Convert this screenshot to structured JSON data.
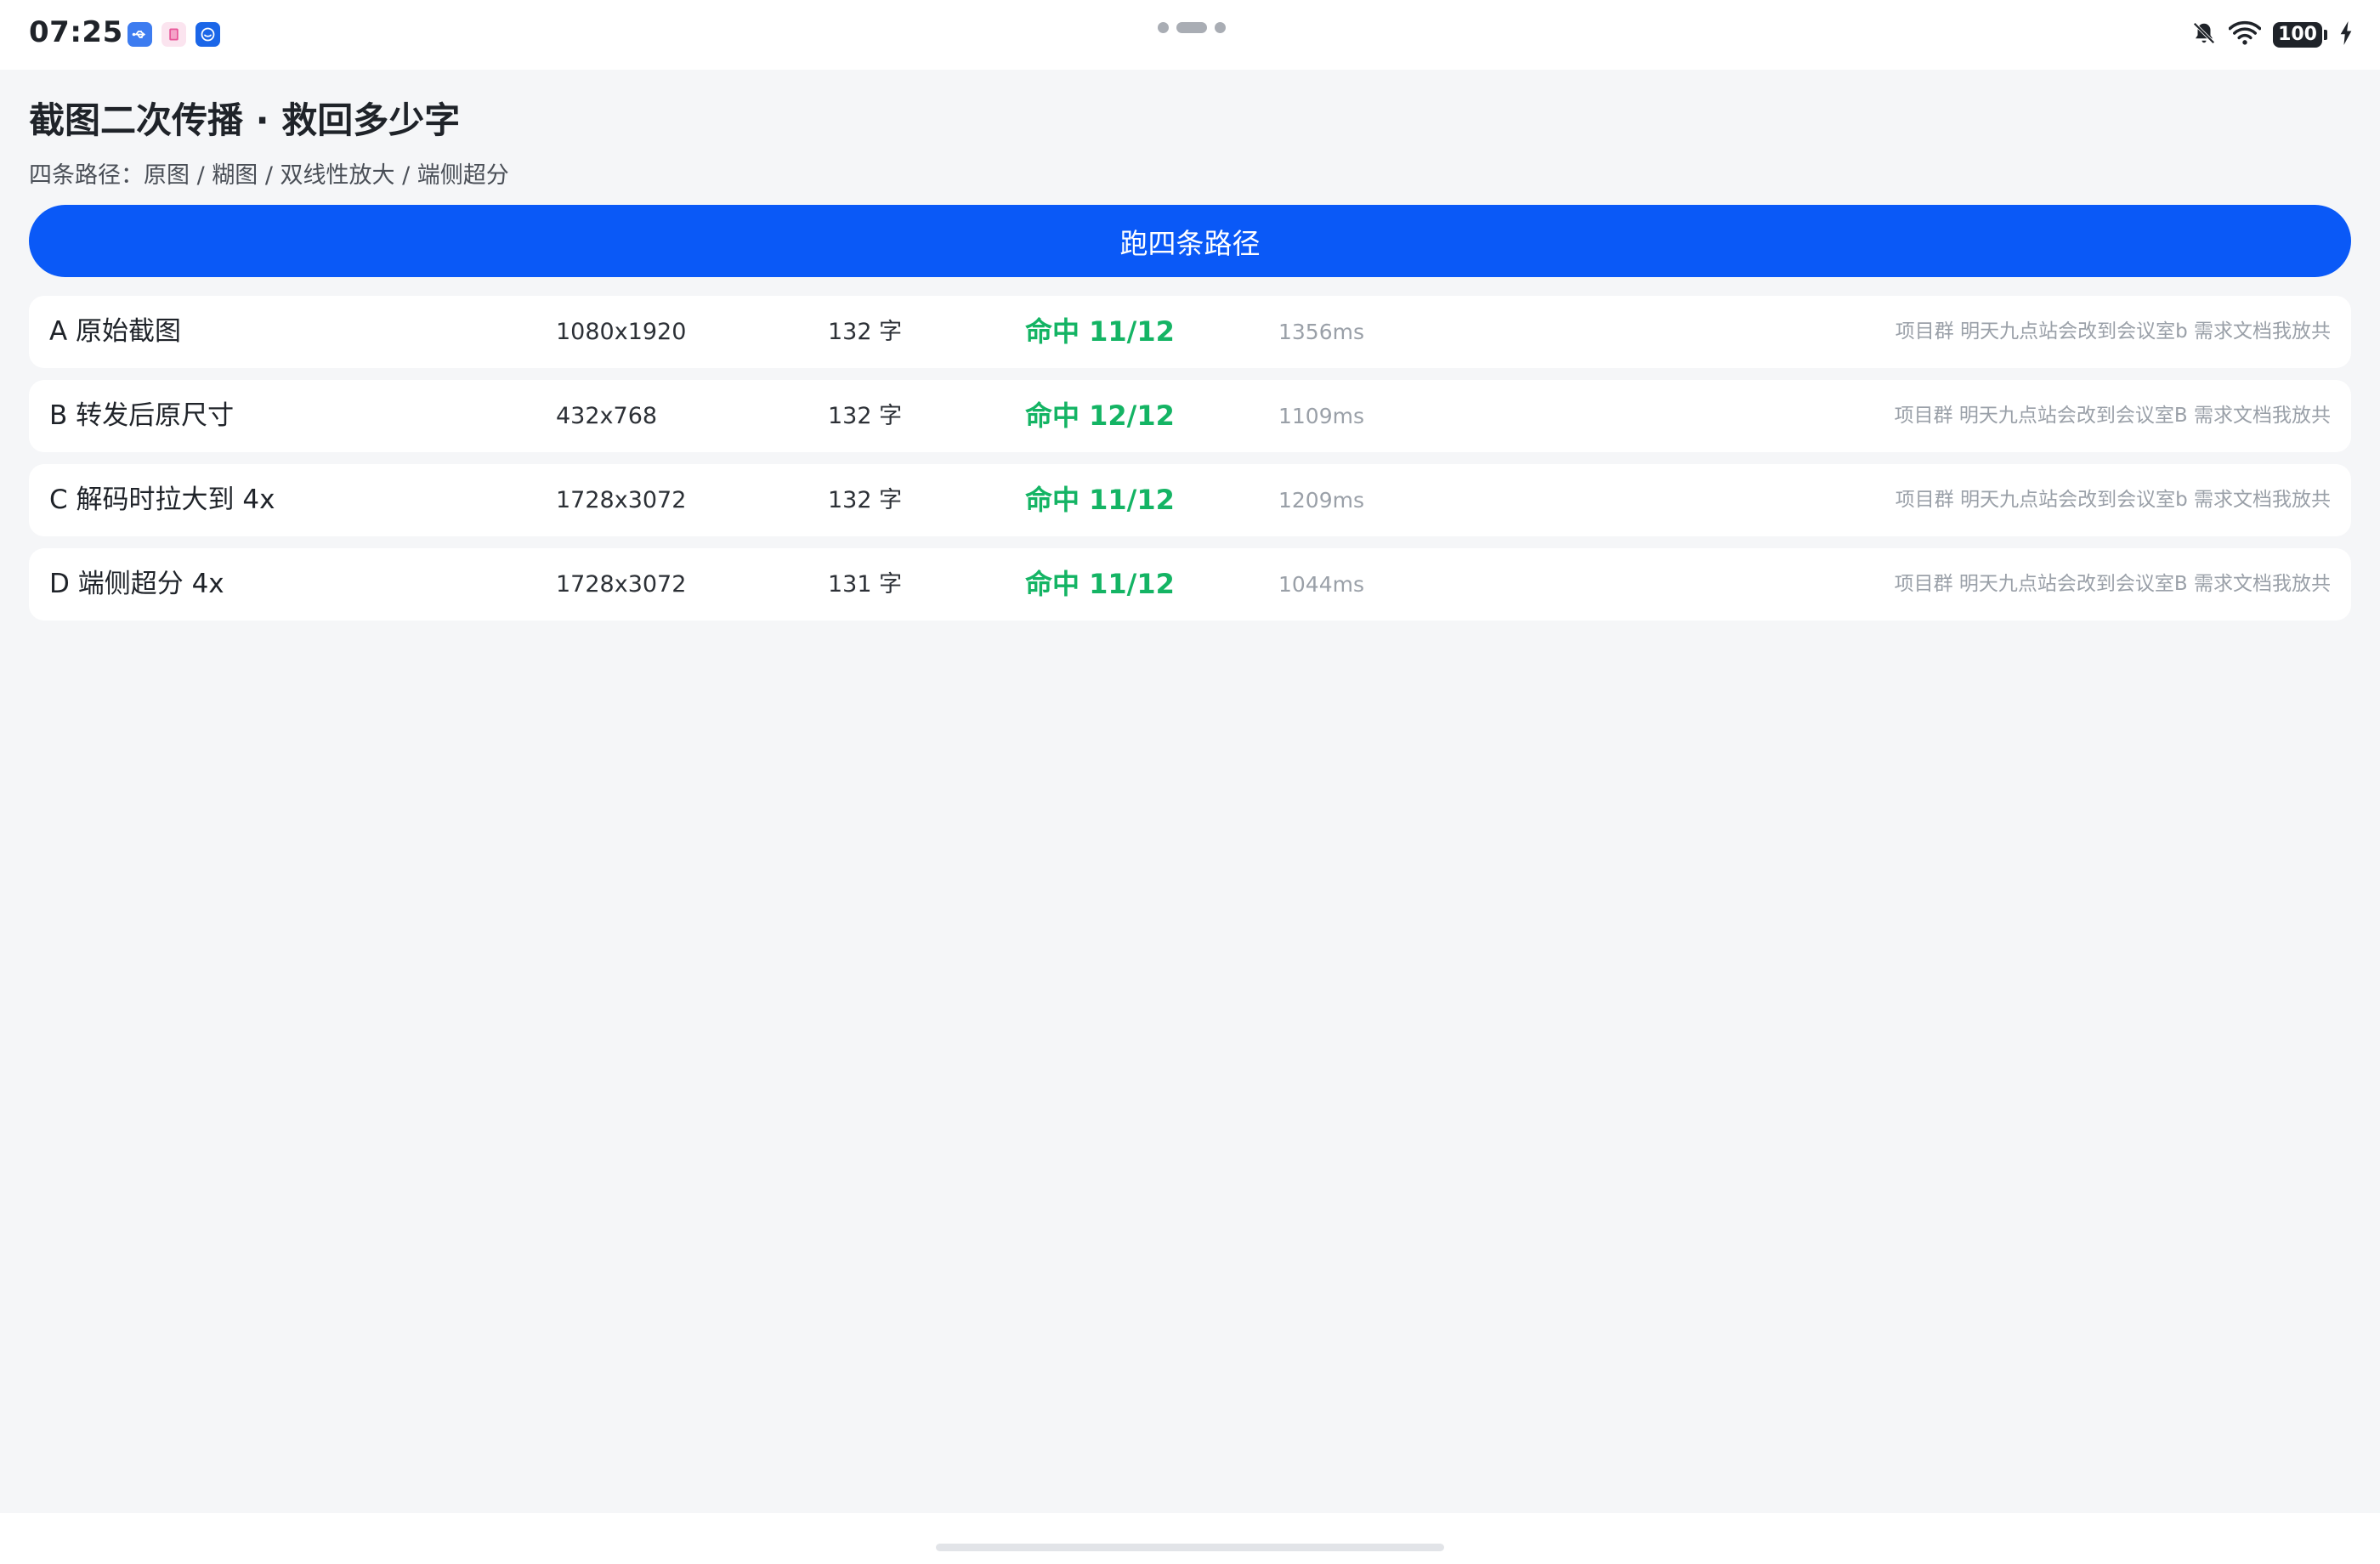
{
  "status_bar": {
    "time": "07:25",
    "app_icons": [
      "usb-icon",
      "books-icon",
      "assistant-icon"
    ],
    "icons": [
      "notifications-muted-icon",
      "wifi-icon",
      "battery-icon",
      "charging-icon"
    ],
    "battery_level": "100"
  },
  "header": {
    "title": "截图二次传播 · 救回多少字",
    "subtitle": "四条路径：原图 / 糊图 / 双线性放大 / 端侧超分"
  },
  "run_button": {
    "label": "跑四条路径"
  },
  "results": [
    {
      "name": "A 原始截图",
      "resolution": "1080x1920",
      "chars": "132 字",
      "hit": "命中 11/12",
      "time": "1356ms",
      "text": "项目群 明天九点站会改到会议室b 需求文档我放共"
    },
    {
      "name": "B 转发后原尺寸",
      "resolution": "432x768",
      "chars": "132 字",
      "hit": "命中 12/12",
      "time": "1109ms",
      "text": "项目群 明天九点站会改到会议室B 需求文档我放共"
    },
    {
      "name": "C 解码时拉大到 4x",
      "resolution": "1728x3072",
      "chars": "132 字",
      "hit": "命中 11/12",
      "time": "1209ms",
      "text": "项目群 明天九点站会改到会议室b 需求文档我放共"
    },
    {
      "name": "D 端侧超分 4x",
      "resolution": "1728x3072",
      "chars": "131 字",
      "hit": "命中 11/12",
      "time": "1044ms",
      "text": "项目群 明天九点站会改到会议室B 需求文档我放共"
    }
  ],
  "colors": {
    "accent": "#0a59f7",
    "hit": "#14b464",
    "background": "#f5f6f8",
    "muted_text": "#9aa0a8"
  }
}
